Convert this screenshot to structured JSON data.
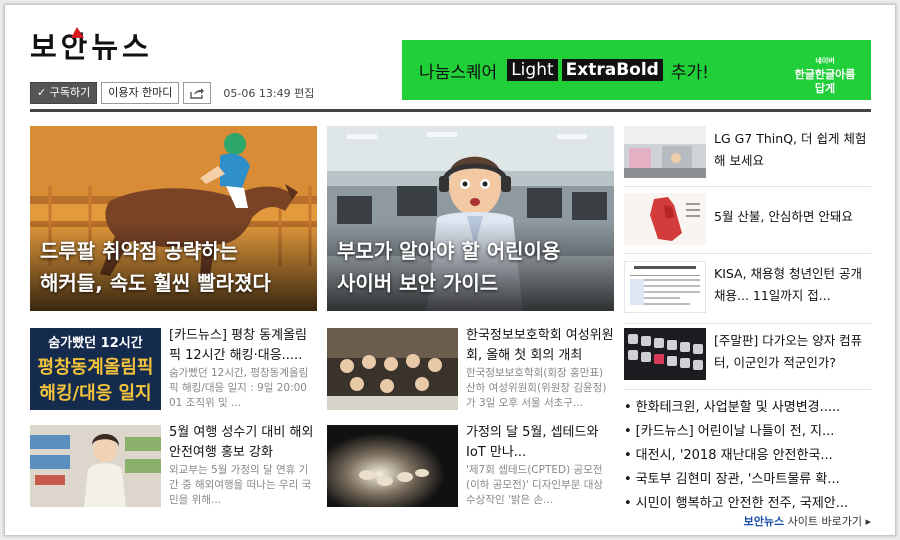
{
  "header": {
    "logo_text": "보안뉴스",
    "subscribe_label": "구독하기",
    "comment_label": "이용자 한마디",
    "timestamp": "05-06 13:49 편집"
  },
  "ad": {
    "text1": "나눔스퀘어",
    "box1": "Light",
    "box2": "ExtraBold",
    "text2": "추가!",
    "logo_small": "네이버",
    "logo_big": "한글한글아름답게"
  },
  "hero": [
    {
      "line1": "드루팔 취약점 공략하는",
      "line2": "해커들, 속도 훨씬 빨라졌다"
    },
    {
      "line1": "부모가 알아야 할 어린이용",
      "line2": "사이버 보안 가이드"
    }
  ],
  "articles": [
    {
      "title": "[카드뉴스] 평창 동계올림픽 12시간 해킹·대응.....",
      "desc": "숨가빴던 12시간, 평창동계올림픽 해킹/대응 일지 : 9일 20:00 01 조직위 및 ...",
      "thumb_text1": "숨가빴던 12시간",
      "thumb_text2": "평창동계올림픽",
      "thumb_text3": "해킹/대응 일지"
    },
    {
      "title": "한국정보보호학회 여성위원회, 올해 첫 회의 개최",
      "desc": "한국정보보호학회(회장 홍만표) 산하 여성위원회(위원장 김윤정)가 3일 오후 서울 서초구..."
    },
    {
      "title": "5월 여행 성수기 대비 해외안전여행 홍보 강화",
      "desc": "외교부는 5월 가정의 달 연휴 기간 중 해외여행을 떠나는 우리 국민을 위해..."
    },
    {
      "title": "가정의 달 5월, 셉테드와 IoT 만나...",
      "desc": "'제7회 셉테드(CPTED) 공모전(이하 공모전)' 디자인부문 대상 수상작인 '밝은 손..."
    }
  ],
  "side": [
    {
      "title": "LG G7 ThinQ, 더 쉽게 체험해 보세요"
    },
    {
      "title": "5월 산불, 안심하면 안돼요"
    },
    {
      "title": "KISA, 채용형 청년인턴 공개채용... 11일까지 접..."
    },
    {
      "title": "[주말판] 다가오는 양자 컴퓨터, 이군인가 적군인가?"
    }
  ],
  "bullets": [
    "한화테크윈, 사업분할 및 사명변경.....",
    "[카드뉴스] 어린이날 나들이 전, 지...",
    "대전시, '2018 재난대응 안전한국...",
    "국토부 김현미 장관, '스마트물류 확...",
    "시민이 행복하고 안전한 전주, 국제안..."
  ],
  "footer": {
    "brand": "보안뉴스",
    "text": "사이트 바로가기 ▸"
  },
  "colors": {
    "ad_green": "#21cf38",
    "divider": "#444444",
    "link_blue": "#1a4ea8"
  }
}
